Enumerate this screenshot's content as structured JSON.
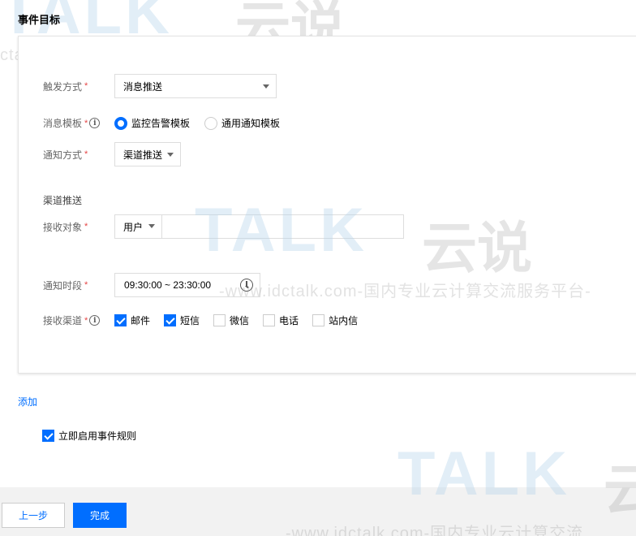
{
  "page": {
    "title": "事件目标"
  },
  "form": {
    "trigger": {
      "label": "触发方式",
      "value": "消息推送"
    },
    "template": {
      "label": "消息模板",
      "options": [
        "监控告警模板",
        "通用通知模板"
      ],
      "selected": 0
    },
    "notify_method": {
      "label": "通知方式",
      "value": "渠道推送"
    },
    "section_title": "渠道推送",
    "receiver": {
      "label": "接收对象",
      "type": "用户",
      "value": ""
    },
    "notify_time": {
      "label": "通知时段",
      "value": "09:30:00 ~ 23:30:00"
    },
    "channels": {
      "label": "接收渠道",
      "items": [
        {
          "label": "邮件",
          "checked": true
        },
        {
          "label": "短信",
          "checked": true
        },
        {
          "label": "微信",
          "checked": false
        },
        {
          "label": "电话",
          "checked": false
        },
        {
          "label": "站内信",
          "checked": false
        }
      ]
    },
    "required_mark": "*",
    "info_glyph": "i"
  },
  "add_link": "添加",
  "enable_rule": {
    "label": "立即启用事件规则",
    "checked": true
  },
  "footer": {
    "prev_label": "上一步",
    "done_label": "完成"
  },
  "watermark": {
    "url_text": "-www.idctalk.com-国内专业云计算交流服务平台-",
    "url_text_top": "ctalk.com-国内专业云计算交流服务平台-",
    "brand": "TALK",
    "brand_cn": "云说",
    "brand_cn_short": "云",
    "url_text_bottom": "-www.idctalk.com-国内专业云计算交流"
  },
  "colors": {
    "accent": "#006eff",
    "required": "#e54545",
    "footer_bg": "#f2f2f2"
  }
}
